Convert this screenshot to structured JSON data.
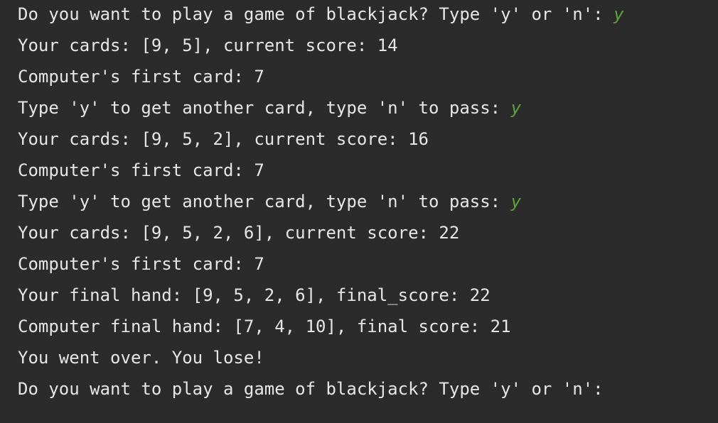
{
  "console": {
    "lines": [
      {
        "text": "Do you want to play a game of blackjack? Type 'y' or 'n': ",
        "input": "y"
      },
      {
        "text": "Your cards: [9, 5], current score: 14",
        "input": ""
      },
      {
        "text": "Computer's first card: 7",
        "input": ""
      },
      {
        "text": "Type 'y' to get another card, type 'n' to pass: ",
        "input": "y"
      },
      {
        "text": "Your cards: [9, 5, 2], current score: 16",
        "input": ""
      },
      {
        "text": "Computer's first card: 7",
        "input": ""
      },
      {
        "text": "Type 'y' to get another card, type 'n' to pass: ",
        "input": "y"
      },
      {
        "text": "Your cards: [9, 5, 2, 6], current score: 22",
        "input": ""
      },
      {
        "text": "Computer's first card: 7",
        "input": ""
      },
      {
        "text": "Your final hand: [9, 5, 2, 6], final_score: 22",
        "input": ""
      },
      {
        "text": "Computer final hand: [7, 4, 10], final score: 21",
        "input": ""
      },
      {
        "text": "You went over. You lose!",
        "input": ""
      },
      {
        "text": "Do you want to play a game of blackjack? Type 'y' or 'n': ",
        "input": ""
      }
    ]
  },
  "colors": {
    "background": "#2b2b2b",
    "output_text": "#e6e6e6",
    "user_input": "#5aa33a"
  }
}
